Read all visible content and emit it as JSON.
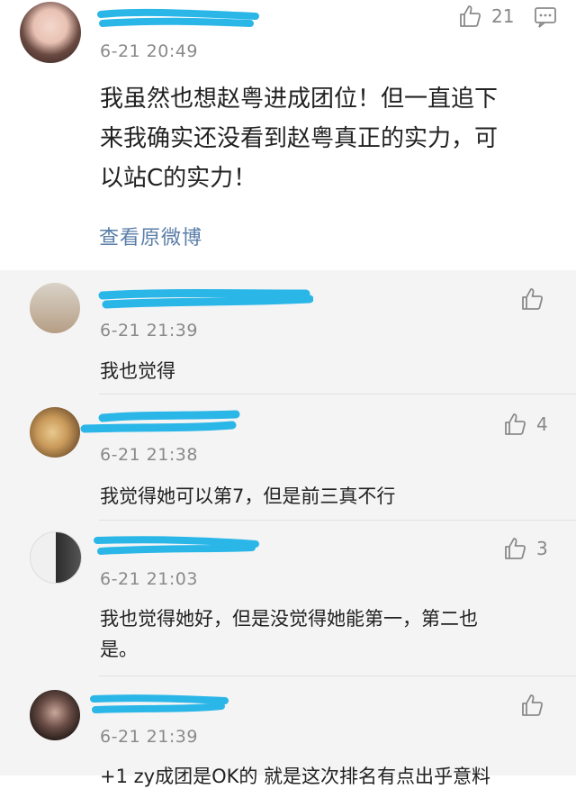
{
  "main_comment": {
    "time": "6-21 20:49",
    "text": "我虽然也想赵粤进成团位！但一直追下来我确实还没看到赵粤真正的实力，可以站C的实力！",
    "line1": "我虽然也想赵粤进成团位！但一直追下",
    "line2": "来我确实还没看到赵粤真正的实力，可",
    "line3": "以站C的实力！",
    "likes": "21",
    "view_original_label": "查看原微博"
  },
  "replies": [
    {
      "time": "6-21 21:39",
      "text": "我也觉得",
      "likes": ""
    },
    {
      "time": "6-21 21:38",
      "text": "我觉得她可以第7，但是前三真不行",
      "likes": "4"
    },
    {
      "time": "6-21 21:03",
      "line1": "我也觉得她好，但是没觉得她能第一，第二也",
      "line2": "是。",
      "likes": "3"
    },
    {
      "time": "6-21 21:39",
      "text": "+1 zy成团是OK的 就是这次排名有点出乎意料",
      "likes": ""
    }
  ],
  "icons": {
    "like": "thumbs-up-icon",
    "comment": "comment-icon"
  },
  "colors": {
    "scribble": "#2bb6e8",
    "link": "#5a7ea8",
    "reply_bg": "#f4f4f4"
  }
}
